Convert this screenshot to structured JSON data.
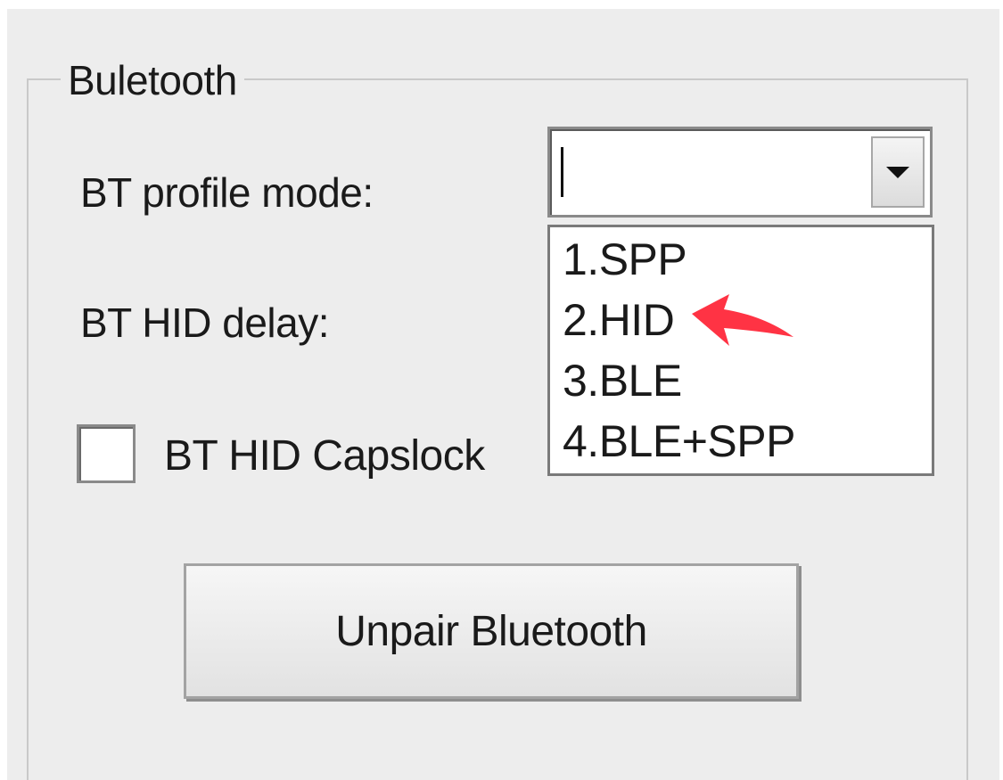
{
  "groupbox": {
    "title": "Buletooth"
  },
  "profile_mode": {
    "label": "BT profile mode:",
    "value": "",
    "options": [
      "1.SPP",
      "2.HID",
      "3.BLE",
      "4.BLE+SPP"
    ],
    "annotated_option": "2.HID"
  },
  "hid_delay": {
    "label": "BT HID delay:"
  },
  "capslock": {
    "label": "BT HID Capslock",
    "checked": false
  },
  "unpair_button": {
    "label": "Unpair Bluetooth"
  },
  "colors": {
    "dialog_bg": "#ededed",
    "annotation_arrow": "#ff3344"
  },
  "icons": {
    "dropdown": "chevron-down-icon",
    "annotation": "red-arrow-icon"
  }
}
